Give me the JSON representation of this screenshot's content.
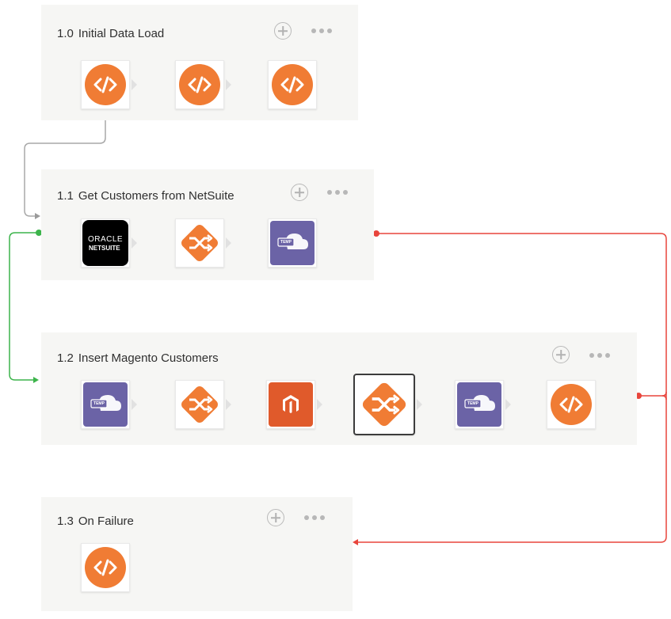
{
  "flows": [
    {
      "number": "1.0",
      "title": "Initial Data Load"
    },
    {
      "number": "1.1",
      "title": "Get Customers from NetSuite"
    },
    {
      "number": "1.2",
      "title": "Insert Magento Customers"
    },
    {
      "number": "1.3",
      "title": "On Failure"
    }
  ],
  "netsuite": {
    "line1": "ORACLE",
    "line2": "NETSUITE"
  },
  "temp_label": "TEMP",
  "icons": [
    "script-icon",
    "oracle-netsuite-icon",
    "transform-icon",
    "temp-cloud-icon",
    "magento-icon"
  ],
  "colors": {
    "orange": "#f07c34",
    "purple": "#6b63a6",
    "magento": "#e05a2b",
    "success_line": "#3cb44b",
    "failure_line": "#e8453c",
    "link_line": "#a8a8a8"
  }
}
